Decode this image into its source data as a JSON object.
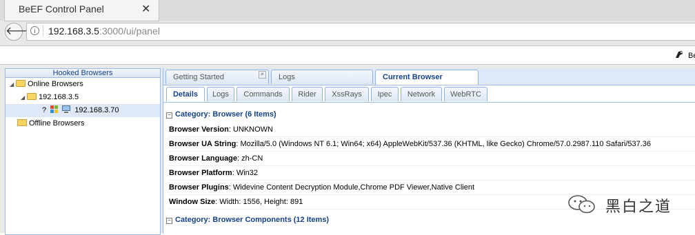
{
  "browser": {
    "tab_title": "BeEF Control Panel",
    "url_host": "192.168.3.5",
    "url_rest": ":3000/ui/panel"
  },
  "topbar": {
    "brand_text": "Be"
  },
  "sidebar": {
    "title": "Hooked Browsers",
    "online_label": "Online Browsers",
    "subnet_label": "192.168.3.5",
    "hooked_ip": "192.168.3.70",
    "hooked_unknown": "?",
    "offline_label": "Offline Browsers"
  },
  "main_tabs": [
    {
      "label": "Getting Started"
    },
    {
      "label": "Logs"
    },
    {
      "label": "Current Browser"
    }
  ],
  "sub_tabs": [
    {
      "label": "Details"
    },
    {
      "label": "Logs"
    },
    {
      "label": "Commands"
    },
    {
      "label": "Rider"
    },
    {
      "label": "XssRays"
    },
    {
      "label": "Ipec"
    },
    {
      "label": "Network"
    },
    {
      "label": "WebRTC"
    }
  ],
  "details": {
    "category_browser": "Category: Browser (6 Items)",
    "rows": [
      {
        "key": "Browser Version",
        "value": ": UNKNOWN"
      },
      {
        "key": "Browser UA String",
        "value": ": Mozilla/5.0 (Windows NT 6.1; Win64; x64) AppleWebKit/537.36 (KHTML, like Gecko) Chrome/57.0.2987.110 Safari/537.36"
      },
      {
        "key": "Browser Language",
        "value": ": zh-CN"
      },
      {
        "key": "Browser Platform",
        "value": ": Win32"
      },
      {
        "key": "Browser Plugins",
        "value": ": Widevine Content Decryption Module,Chrome PDF Viewer,Native Client"
      },
      {
        "key": "Window Size",
        "value": ": Width: 1556, Height: 891"
      }
    ],
    "category_components": "Category: Browser Components (12 Items)"
  },
  "watermark": {
    "text": "黑白之道"
  },
  "colors": {
    "accent": "#15428b",
    "border": "#99bbe8",
    "selection": "#dfe8f6"
  }
}
